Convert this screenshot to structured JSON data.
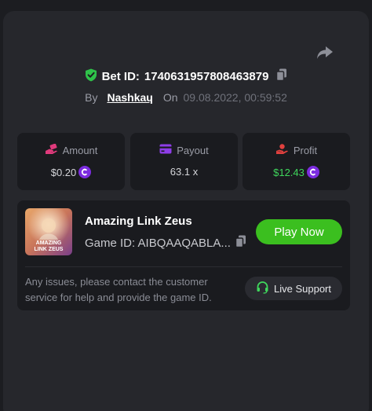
{
  "bet": {
    "label": "Bet ID:",
    "id": "1740631957808463879",
    "by_label": "By",
    "user": "Nashkaɥ",
    "on_label": "On",
    "date": "09.08.2022, 00:59:52"
  },
  "stats": [
    {
      "label": "Amount",
      "value": "$0.20",
      "icon": "hand-coin-icon",
      "color": "#e03a7c"
    },
    {
      "label": "Payout",
      "value": "63.1 x",
      "icon": "card-icon",
      "color": "#8e3de8"
    },
    {
      "label": "Profit",
      "value": "$12.43",
      "icon": "hand-money-icon",
      "color": "#e0403e"
    }
  ],
  "game": {
    "name": "Amazing Link Zeus",
    "id_text": "Game ID: AIBQAAQABLA...",
    "thumb_line1": "AMAZING",
    "thumb_line2": "LINK ZEUS",
    "play_label": "Play Now"
  },
  "support": {
    "help_text": "Any issues, please contact the customer service for help and provide the game ID.",
    "button_label": "Live Support"
  },
  "colors": {
    "accent_green": "#3bbf1f",
    "profit_green": "#3fd65c",
    "coin_purple": "#7c2ce0",
    "shield_green": "#2fc24a"
  }
}
